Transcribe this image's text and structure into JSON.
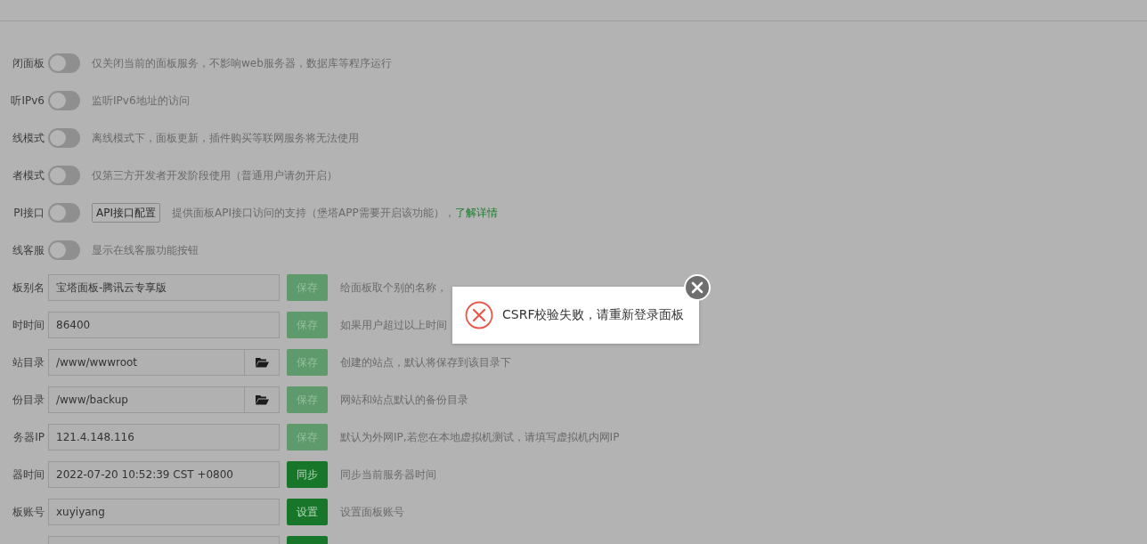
{
  "settings": [
    {
      "kind": "toggle",
      "label": "闭面板",
      "on": false,
      "description": "仅关闭当前的面板服务，不影响web服务器，数据库等程序运行"
    },
    {
      "kind": "toggle",
      "label": "听IPv6",
      "on": false,
      "description": "监听IPv6地址的访问"
    },
    {
      "kind": "toggle",
      "label": "线模式",
      "on": false,
      "description": "离线模式下，面板更新，插件购买等联网服务将无法使用"
    },
    {
      "kind": "toggle",
      "label": "者模式",
      "on": false,
      "description": "仅第三方开发者开发阶段使用（普通用户请勿开启）"
    },
    {
      "kind": "toggle",
      "label": "PI接口",
      "on": false,
      "config_button": "API接口配置",
      "description": "提供面板API接口访问的支持（堡塔APP需要开启该功能），",
      "link": "了解详情"
    },
    {
      "kind": "toggle",
      "label": "线客服",
      "on": false,
      "description": "显示在线客服功能按钮"
    },
    {
      "kind": "field",
      "label": "板别名",
      "value": "宝塔面板-腾讯云专享版",
      "button": "保存",
      "disabled": true,
      "description": "给面板取个别的名称，"
    },
    {
      "kind": "field",
      "label": "时时间",
      "value": "86400",
      "button": "保存",
      "disabled": true,
      "description": "如果用户超过以上时间"
    },
    {
      "kind": "path",
      "label": "站目录",
      "value": "/www/wwwroot",
      "button": "保存",
      "disabled": true,
      "description": "创建的站点，默认将保存到该目录下"
    },
    {
      "kind": "path",
      "label": "份目录",
      "value": "/www/backup",
      "button": "保存",
      "disabled": true,
      "description": "网站和站点默认的备份目录"
    },
    {
      "kind": "field",
      "label": "务器IP",
      "value": "121.4.148.116",
      "button": "保存",
      "disabled": true,
      "description": "默认为外网IP,若您在本地虚拟机测试，请填写虚拟机内网IP"
    },
    {
      "kind": "field",
      "label": "器时间",
      "value": "2022-07-20 10:52:39 CST +0800",
      "button": "同步",
      "disabled": false,
      "description": "同步当前服务器时间"
    },
    {
      "kind": "field",
      "label": "板账号",
      "value": "xuyiyang",
      "button": "设置",
      "disabled": false,
      "description": "设置面板账号"
    },
    {
      "kind": "cut",
      "disabled": false
    }
  ],
  "dialog": {
    "message": "CSRF校验失败，请重新登录面板"
  }
}
